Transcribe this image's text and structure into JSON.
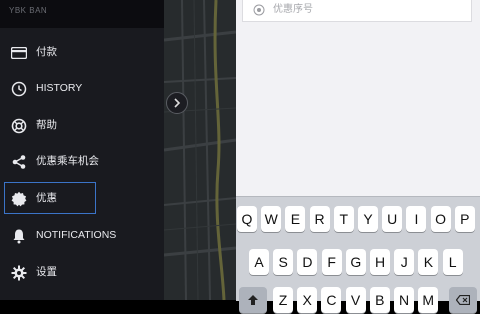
{
  "drawer": {
    "user_name": "YBK BAN",
    "items": [
      {
        "label": "付款",
        "icon": "card-icon"
      },
      {
        "label": "HISTORY",
        "icon": "history-icon"
      },
      {
        "label": "帮助",
        "icon": "help-lifebuoy-icon"
      },
      {
        "label": "优惠乘车机会",
        "icon": "share-icon"
      },
      {
        "label": "优惠",
        "icon": "promo-badge-icon",
        "selected": true
      },
      {
        "label": "NOTIFICATIONS",
        "icon": "bell-icon"
      },
      {
        "label": "设置",
        "icon": "gear-icon"
      }
    ]
  },
  "promo": {
    "placeholder": "优惠序号"
  },
  "keyboard": {
    "row1": [
      "Q",
      "W",
      "E",
      "R",
      "T",
      "Y",
      "U",
      "I",
      "O",
      "P"
    ],
    "row2": [
      "A",
      "S",
      "D",
      "F",
      "G",
      "H",
      "J",
      "K",
      "L"
    ],
    "row3": [
      "Z",
      "X",
      "C",
      "V",
      "B",
      "N",
      "M"
    ]
  },
  "colors": {
    "drawer_bg": "#191a1f",
    "selected_outline": "#3b74c8",
    "panel_bg": "#f2f2f5",
    "keyboard_bg": "#cdd0d6"
  }
}
